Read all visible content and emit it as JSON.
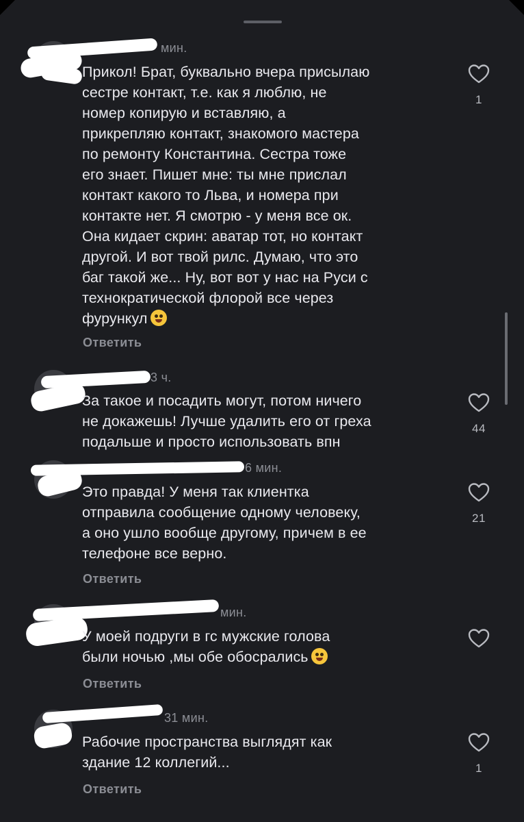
{
  "colors": {
    "background": "#1c1d21",
    "text": "#e9e9ee",
    "meta_text": "#8c8e95",
    "redaction": "#ffffff"
  },
  "comments": [
    {
      "time": "мин.",
      "text_lines": [
        "Прикол! Брат, буквально вчера присылаю",
        "сестре контакт, т.е. как я люблю, не",
        "номер копирую и вставляю, а",
        "прикрепляю контакт, знакомого мастера",
        "по ремонту Константина. Сестра тоже",
        "его знает. Пишет мне: ты мне прислал",
        "контакт какого то Льва, и номера при",
        "контакте нет. Я смотрю - у меня все ок.",
        "Она кидает скрин: аватар тот, но контакт",
        "другой. И вот твой рилс. Думаю, что это",
        "баг такой же...  Ну, вот вот у нас на Руси с",
        "технократической флорой все через",
        "фурункул"
      ],
      "emoji": "zany-face-emoji",
      "reply_label": "Ответить",
      "likes": "1"
    },
    {
      "time": "3 ч.",
      "text_lines": [
        "За такое и посадить могут, потом ничего",
        "не докажешь! Лучше удалить его от греха",
        "подальше и просто использовать впн"
      ],
      "likes": "44"
    },
    {
      "time": "6 мин.",
      "text_lines": [
        "Это правда! У меня так клиентка",
        "отправила сообщение одному человеку,",
        "а оно ушло вообще другому, причем в ее",
        "телефоне все верно."
      ],
      "reply_label": "Ответить",
      "likes": "21"
    },
    {
      "time": "мин.",
      "text_lines": [
        "У моей подруги в гс мужские голова",
        "были ночью ,мы обе обосрались"
      ],
      "emoji": "tears-of-joy-emoji",
      "reply_label": "Ответить",
      "likes": ""
    },
    {
      "time": "31 мин.",
      "text_lines": [
        "Рабочие пространства выглядят как",
        "здание 12 коллегий..."
      ],
      "reply_label": "Ответить",
      "likes": "1"
    }
  ],
  "icons": {
    "like": "heart-outline-icon",
    "drag_handle": "sheet-drag-handle",
    "scrollbar": "scrollbar-thumb"
  }
}
